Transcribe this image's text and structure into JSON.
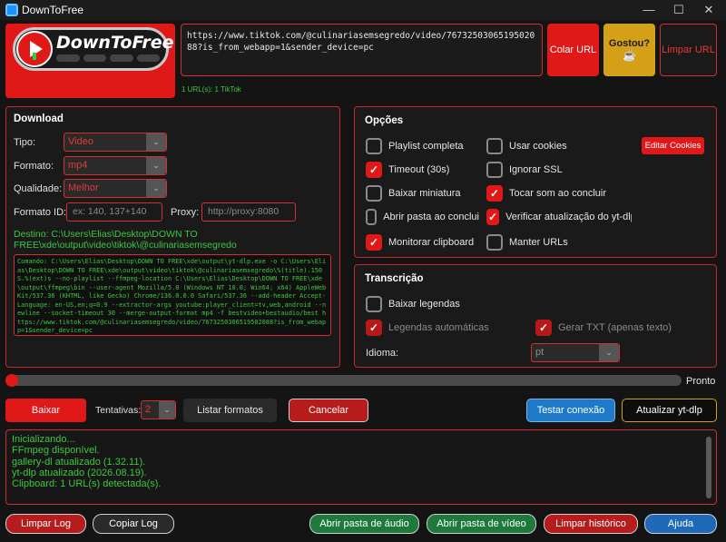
{
  "window": {
    "title": "DownToFree",
    "minimize": "—",
    "maximize": "☐",
    "close": "✕"
  },
  "logo": {
    "text": "DownToFree"
  },
  "url_input": {
    "value": "https://www.tiktok.com/@culinariasemsegredo/video/7673250306519502088?is_from_webapp=1&sender_device=pc",
    "count_text": "1 URL(s): 1 TikTok"
  },
  "top_buttons": {
    "paste": "Colar URL",
    "liked": "Gostou?",
    "liked_icon": "☕",
    "clear": "Limpar URL"
  },
  "download": {
    "title": "Download",
    "type_label": "Tipo:",
    "type_value": "Video",
    "format_label": "Formato:",
    "format_value": "mp4",
    "quality_label": "Qualidade:",
    "quality_value": "Melhor",
    "format_id_label": "Formato ID:",
    "format_id_placeholder": "ex: 140, 137+140",
    "proxy_label": "Proxy:",
    "proxy_placeholder": "http://proxy:8080",
    "destination": "Destino: C:\\Users\\Elias\\Desktop\\DOWN TO FREE\\xde\\output\\video\\tiktok\\@culinariasemsegredo",
    "command": "Comando: C:\\Users\\Elias\\Desktop\\DOWN TO FREE\\xde\\output\\yt-dlp.exe -o C:\\Users\\Elias\\Desktop\\DOWN TO FREE\\xde\\output\\video\\tiktok\\@culinariasemsegredo\\%(title).150S.%(ext)s --no-playlist --ffmpeg-location C:\\Users\\Elias\\Desktop\\DOWN TO FREE\\xde\\output\\ffmpeg\\bin --user-agent Mozilla/5.0 (Windows NT 10.0; Win64; x64) AppleWebKit/537.36 (KHTML, like Gecko) Chrome/136.0.0.0 Safari/537.36 --add-header Accept-Language: en-US,en;q=0.9 --extractor-args youtube:player_client=tv,web,android --newline --socket-timeout 30 --merge-output-format mp4 -f bestvideo+bestaudio/best https://www.tiktok.com/@culinariasemsegredo/video/7673250306519502088?is_from_webapp=1&sender_device=pc"
  },
  "options": {
    "title": "Opções",
    "edit_cookies": "Editar Cookies",
    "items": [
      {
        "label": "Playlist completa",
        "checked": false
      },
      {
        "label": "Usar cookies",
        "checked": false
      },
      {
        "label": "Timeout (30s)",
        "checked": true
      },
      {
        "label": "Ignorar SSL",
        "checked": false
      },
      {
        "label": "Baixar miniatura",
        "checked": false
      },
      {
        "label": "Tocar som ao concluir",
        "checked": true
      },
      {
        "label": "Abrir pasta ao conclui",
        "checked": false
      },
      {
        "label": "Verificar atualização do yt-dlp",
        "checked": true
      },
      {
        "label": "Monitorar clipboard",
        "checked": true
      },
      {
        "label": "Manter URLs",
        "checked": false
      }
    ]
  },
  "transcription": {
    "title": "Transcrição",
    "download_subs": "Baixar legendas",
    "auto_subs": "Legendas automáticas",
    "txt": "Gerar TXT (apenas texto)",
    "language_label": "Idioma:",
    "language_value": "pt"
  },
  "progress": {
    "value": 0,
    "text": "Pronto"
  },
  "actions": {
    "download": "Baixar",
    "retries_label": "Tentativas:",
    "retries_value": "2",
    "list_formats": "Listar formatos",
    "cancel": "Cancelar",
    "test_connection": "Testar conexão",
    "update": "Atualizar yt-dlp"
  },
  "log": {
    "lines": [
      "Inicializando...",
      "FFmpeg disponível.",
      "gallery-dl atualizado (1.32.11).",
      "yt-dlp atualizado (2026.08.19).",
      "Clipboard: 1 URL(s) detectada(s)."
    ]
  },
  "bottom_buttons": {
    "clear_log": "Limpar Log",
    "copy_log": "Copiar Log",
    "audio_folder": "Abrir pasta de áudio",
    "video_folder": "Abrir pasta de vídeo",
    "clear_history": "Limpar histórico",
    "help": "Ajuda"
  },
  "colors": {
    "accent_red": "#e01818",
    "border_red": "#d32f2f",
    "log_green": "#3cc83c",
    "gold": "#d4a017",
    "blue": "#1e7ac8",
    "background": "#141414"
  }
}
